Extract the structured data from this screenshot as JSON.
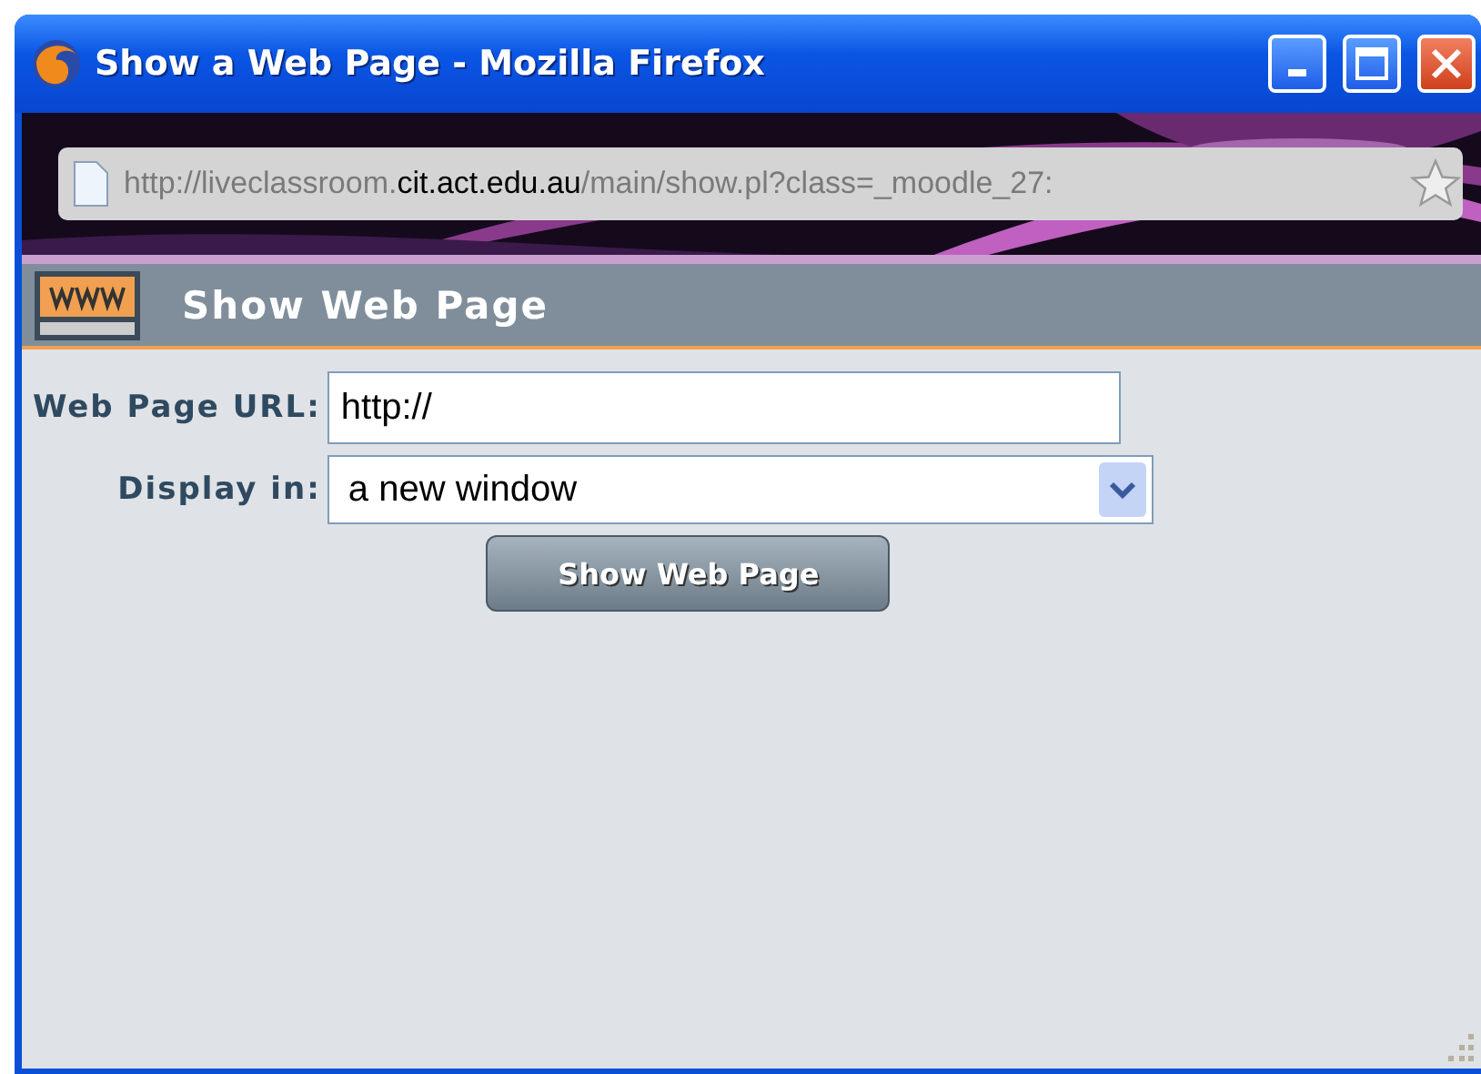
{
  "window": {
    "title": "Show a Web Page - Mozilla Firefox"
  },
  "address_bar": {
    "prefix": "http://liveclassroom.",
    "domain": "cit.act.edu.au",
    "suffix": "/main/show.pl?class=_moodle_27:"
  },
  "panel": {
    "title": "Show Web Page"
  },
  "form": {
    "url_label": "Web Page URL:",
    "url_value": "http://",
    "display_label": "Display in:",
    "display_value": "a new window",
    "button": "Show Web Page"
  }
}
